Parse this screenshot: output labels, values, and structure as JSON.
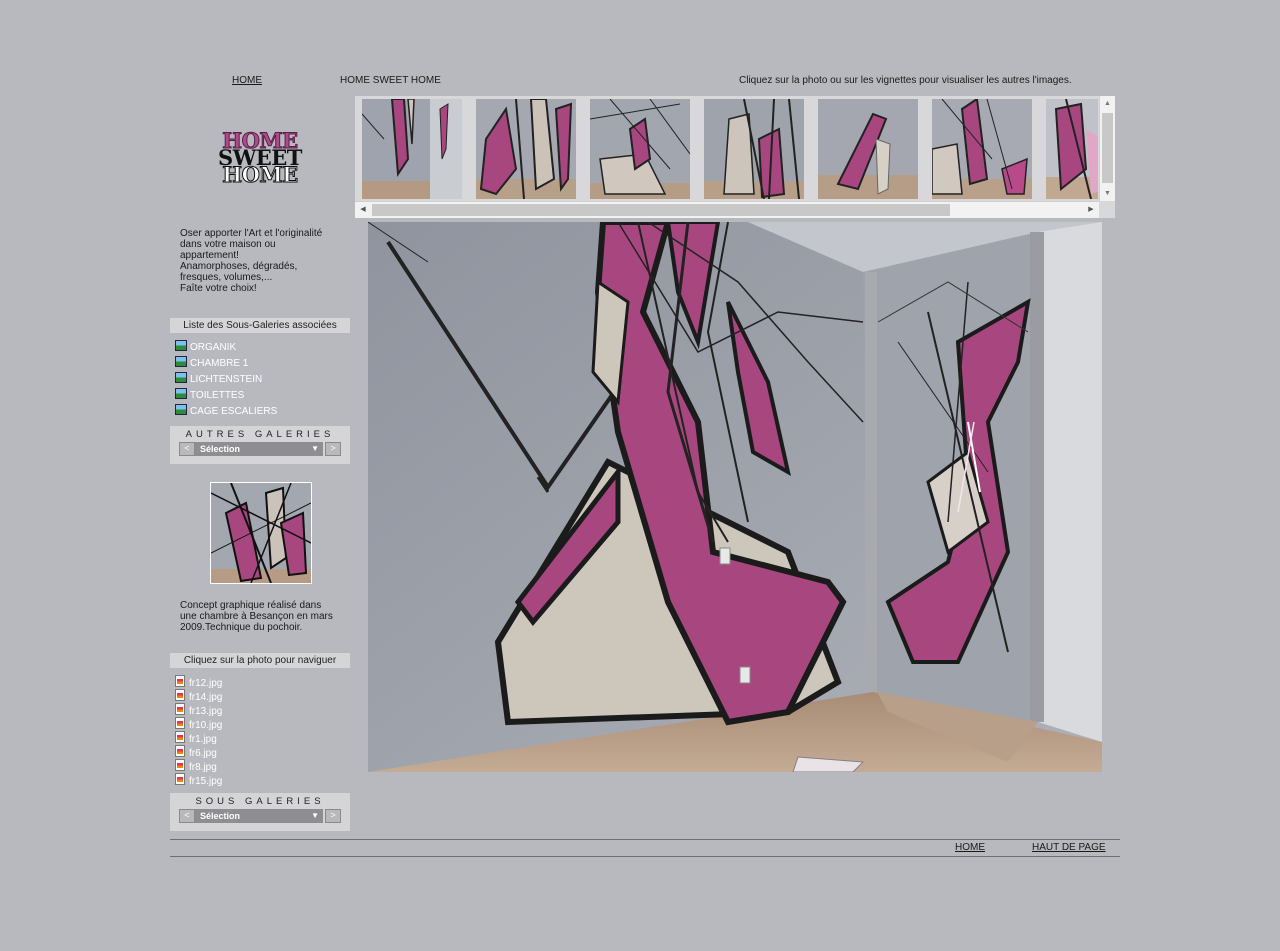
{
  "topnav": {
    "home_label": "HOME",
    "gallery_title": "HOME SWEET HOME",
    "hint": "Cliquez sur la photo ou sur les vignettes pour visualiser les autres l'images."
  },
  "logo": {
    "line1": "HOME",
    "line2": "SWEET",
    "line3": "HOME"
  },
  "intro": {
    "lines": [
      "Oser apporter l'Art et l'originalité",
      "dans votre maison ou",
      "appartement!",
      "Anamorphoses, dégradés,",
      "fresques, volumes,...",
      "Faîte votre choix!"
    ]
  },
  "subgalleries": {
    "header": "Liste des Sous-Galeries associées",
    "items": [
      "ORGANIK",
      "CHAMBRE 1",
      "LICHTENSTEIN",
      "TOILETTES",
      "CAGE ESCALIERS"
    ]
  },
  "other_galleries": {
    "title": "AUTRES GALERIES",
    "prev": "<",
    "next": ">",
    "selected": "Sélection",
    "arrow": "▼"
  },
  "caption": {
    "lines": [
      "Concept graphique réalisé dans",
      "une chambre à Besançon en mars",
      "2009.Technique du pochoir."
    ]
  },
  "navigate": {
    "header": "Cliquez sur la photo pour naviguer",
    "files": [
      "fr12.jpg",
      "fr14.jpg",
      "fr13.jpg",
      "fr10.jpg",
      "fr1.jpg",
      "fr6.jpg",
      "fr8.jpg",
      "fr15.jpg"
    ]
  },
  "sub_gallery_select": {
    "title": "SOUS GALERIES",
    "prev": "<",
    "next": ">",
    "selected": "Sélection",
    "arrow": "▼"
  },
  "footer": {
    "home_label": "HOME",
    "top_label": "HAUT DE PAGE"
  },
  "colors": {
    "background": "#b8b9be",
    "panel": "#d5d5d7",
    "mural_pink": "#a8477f",
    "wall_grey": "#9ea2ab",
    "floor": "#b79c86"
  },
  "icons": {
    "gallery": "gallery-icon",
    "file": "image-file-icon",
    "scroll_up": "scroll-up-arrow-icon",
    "scroll_down": "scroll-down-arrow-icon",
    "scroll_left": "scroll-left-arrow-icon",
    "scroll_right": "scroll-right-arrow-icon"
  }
}
